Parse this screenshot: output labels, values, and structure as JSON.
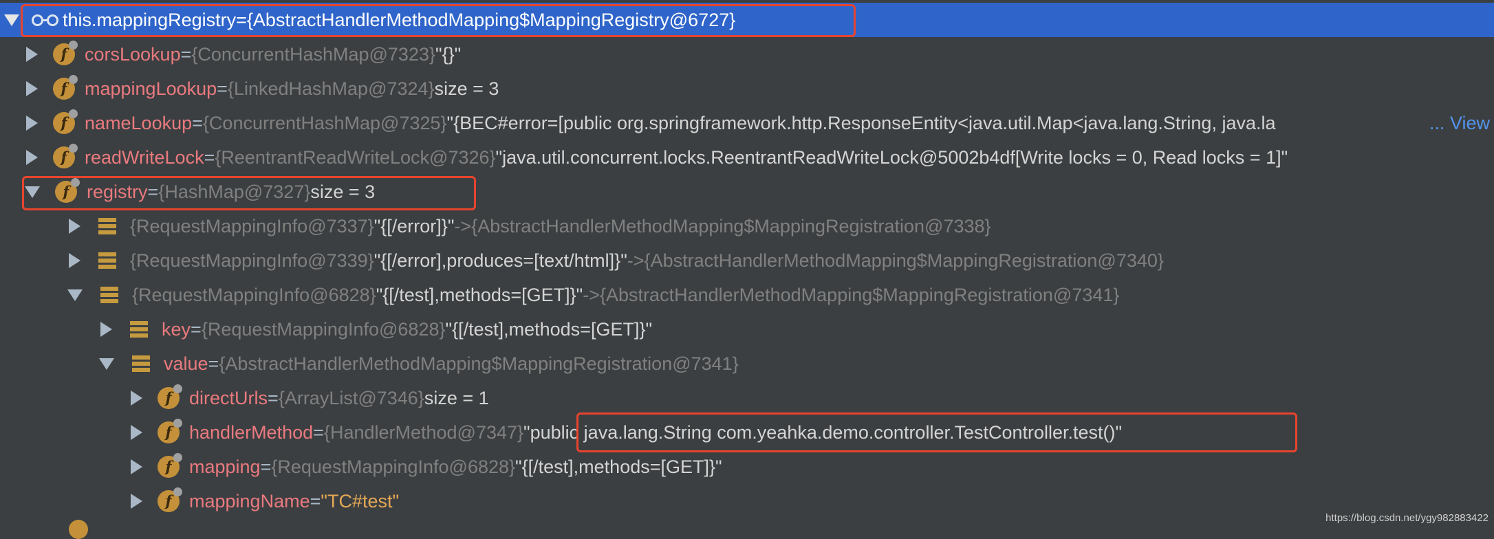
{
  "colors": {
    "background": "#3c3f41",
    "selection": "#2f65ca",
    "field_name": "#ea7a7f",
    "type_label": "#808080",
    "value": "#d4d4d4",
    "link": "#5394ec",
    "highlight_box": "#e8442e",
    "string_value": "#e6a954"
  },
  "root": {
    "name": "this.mappingRegistry",
    "eq": " = ",
    "type": "{AbstractHandlerMethodMapping$MappingRegistry@6727}"
  },
  "rows": [
    {
      "name": "corsLookup",
      "eq": " = ",
      "type": "{ConcurrentHashMap@7323}",
      "value": " \"{}\""
    },
    {
      "name": "mappingLookup",
      "eq": " = ",
      "type": "{LinkedHashMap@7324}",
      "value": "  size = 3"
    },
    {
      "name": "nameLookup",
      "eq": " = ",
      "type": "{ConcurrentHashMap@7325}",
      "value": " \"{BEC#error=[public org.springframework.http.ResponseEntity<java.util.Map<java.lang.String, java.la",
      "ellipsis": "...",
      "link": "View"
    },
    {
      "name": "readWriteLock",
      "eq": " = ",
      "type": "{ReentrantReadWriteLock@7326}",
      "value": " \"java.util.concurrent.locks.ReentrantReadWriteLock@5002b4df[Write locks = 0, Read locks = 1]\""
    },
    {
      "name": "registry",
      "eq": " = ",
      "type": "{HashMap@7327}",
      "value": "  size = 3"
    },
    {
      "type": "{RequestMappingInfo@7337}",
      "value": " \"{[/error]}\"",
      "arrow": " -> ",
      "target": "{AbstractHandlerMethodMapping$MappingRegistration@7338}"
    },
    {
      "type": "{RequestMappingInfo@7339}",
      "value": " \"{[/error],produces=[text/html]}\"",
      "arrow": " -> ",
      "target": "{AbstractHandlerMethodMapping$MappingRegistration@7340}"
    },
    {
      "type": "{RequestMappingInfo@6828}",
      "value": " \"{[/test],methods=[GET]}\"",
      "arrow": " -> ",
      "target": "{AbstractHandlerMethodMapping$MappingRegistration@7341}"
    },
    {
      "name": "key",
      "eq": " = ",
      "type": "{RequestMappingInfo@6828}",
      "value": " \"{[/test],methods=[GET]}\""
    },
    {
      "name": "value",
      "eq": " = ",
      "type": "{AbstractHandlerMethodMapping$MappingRegistration@7341}"
    },
    {
      "name": "directUrls",
      "eq": " = ",
      "type": "{ArrayList@7346}",
      "value": "  size = 1"
    },
    {
      "name": "handlerMethod",
      "eq": " = ",
      "type": "{HandlerMethod@7347}",
      "value": " \"public java.lang.String com.yeahka.demo.controller.TestController.test()\""
    },
    {
      "name": "mapping",
      "eq": " = ",
      "type": "{RequestMappingInfo@6828}",
      "value": " \"{[/test],methods=[GET]}\""
    },
    {
      "name": "mappingName",
      "eq": " = ",
      "value": "\"TC#test\""
    }
  ],
  "watermark": "https://blog.csdn.net/ygy982883422"
}
